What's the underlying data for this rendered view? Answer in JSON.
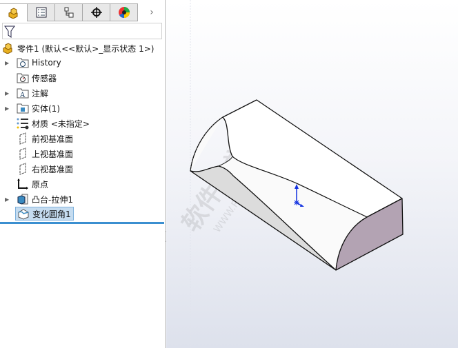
{
  "panel": {
    "tabs": [
      "feature-manager",
      "property-manager",
      "configuration-manager",
      "dimxpert-manager",
      "display-manager"
    ],
    "more": "›",
    "root": "零件1  (默认<<默认>_显示状态 1>)",
    "items": [
      {
        "label": "History",
        "expandable": true,
        "icon": "history-folder-icon"
      },
      {
        "label": "传感器",
        "expandable": false,
        "icon": "sensor-folder-icon"
      },
      {
        "label": "注解",
        "expandable": true,
        "icon": "annotation-folder-icon"
      },
      {
        "label": "实体(1)",
        "expandable": true,
        "icon": "solid-bodies-folder-icon"
      },
      {
        "label": "材质 <未指定>",
        "expandable": false,
        "icon": "material-icon"
      },
      {
        "label": "前视基准面",
        "expandable": false,
        "icon": "plane-icon"
      },
      {
        "label": "上视基准面",
        "expandable": false,
        "icon": "plane-icon"
      },
      {
        "label": "右视基准面",
        "expandable": false,
        "icon": "plane-icon"
      },
      {
        "label": "原点",
        "expandable": false,
        "icon": "origin-icon"
      },
      {
        "label": "凸台-拉伸1",
        "expandable": true,
        "icon": "extrude-icon"
      },
      {
        "label": "变化圆角1",
        "expandable": false,
        "icon": "variable-fillet-icon",
        "selected": true
      }
    ]
  },
  "viewport": {
    "watermark": "软件自学网",
    "watermark_url": "WWW.RJZXW.COM",
    "face_color": "#b3a3b3"
  }
}
